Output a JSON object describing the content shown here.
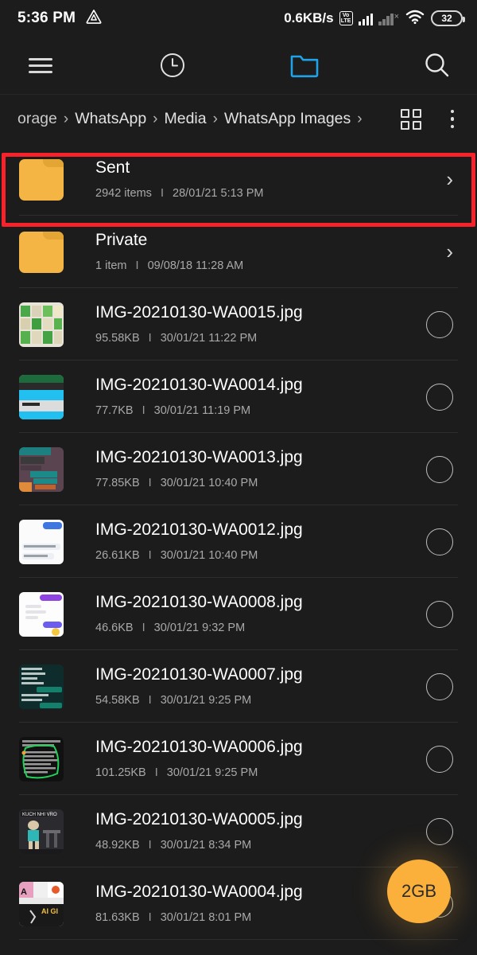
{
  "status_bar": {
    "time": "5:36 PM",
    "drive_icon": "triangle-icon",
    "network_speed": "0.6KB/s",
    "volte_top": "Vo",
    "volte_bottom": "LTE",
    "battery_level": "32"
  },
  "toolbar": {
    "menu_icon": "hamburger-menu-icon",
    "recent_icon": "clock-icon",
    "folder_icon": "folder-icon",
    "search_icon": "search-icon",
    "active_color": "#1fa2e8"
  },
  "breadcrumb": {
    "items": [
      {
        "label": "orage"
      },
      {
        "label": "WhatsApp"
      },
      {
        "label": "Media"
      },
      {
        "label": "WhatsApp Images"
      }
    ],
    "separator": "›",
    "grid_view_icon": "grid-view-icon",
    "overflow_icon": "more-options-icon"
  },
  "list": {
    "items": [
      {
        "type": "folder",
        "name": "Sent",
        "meta_count": "2942 items",
        "meta_sep": "I",
        "meta_date": "28/01/21 5:13 PM",
        "chevron": "›",
        "highlighted": true
      },
      {
        "type": "folder",
        "name": "Private",
        "meta_count": "1 item",
        "meta_sep": "I",
        "meta_date": "09/08/18 11:28 AM",
        "chevron": "›",
        "highlighted": false
      },
      {
        "type": "file",
        "name": "IMG-20210130-WA0015.jpg",
        "meta_count": "95.58KB",
        "meta_sep": "I",
        "meta_date": "30/01/21 11:22 PM"
      },
      {
        "type": "file",
        "name": "IMG-20210130-WA0014.jpg",
        "meta_count": "77.7KB",
        "meta_sep": "I",
        "meta_date": "30/01/21 11:19 PM"
      },
      {
        "type": "file",
        "name": "IMG-20210130-WA0013.jpg",
        "meta_count": "77.85KB",
        "meta_sep": "I",
        "meta_date": "30/01/21 10:40 PM"
      },
      {
        "type": "file",
        "name": "IMG-20210130-WA0012.jpg",
        "meta_count": "26.61KB",
        "meta_sep": "I",
        "meta_date": "30/01/21 10:40 PM"
      },
      {
        "type": "file",
        "name": "IMG-20210130-WA0008.jpg",
        "meta_count": "46.6KB",
        "meta_sep": "I",
        "meta_date": "30/01/21 9:32 PM"
      },
      {
        "type": "file",
        "name": "IMG-20210130-WA0007.jpg",
        "meta_count": "54.58KB",
        "meta_sep": "I",
        "meta_date": "30/01/21 9:25 PM"
      },
      {
        "type": "file",
        "name": "IMG-20210130-WA0006.jpg",
        "meta_count": "101.25KB",
        "meta_sep": "I",
        "meta_date": "30/01/21 9:25 PM"
      },
      {
        "type": "file",
        "name": "IMG-20210130-WA0005.jpg",
        "meta_count": "48.92KB",
        "meta_sep": "I",
        "meta_date": "30/01/21 8:34 PM"
      },
      {
        "type": "file",
        "name": "IMG-20210130-WA0004.jpg",
        "meta_count": "81.63KB",
        "meta_sep": "I",
        "meta_date": "30/01/21 8:01 PM"
      }
    ]
  },
  "fab": {
    "label": "2GB",
    "color": "#fbb03b"
  },
  "highlight": {
    "color": "#f8232a"
  }
}
